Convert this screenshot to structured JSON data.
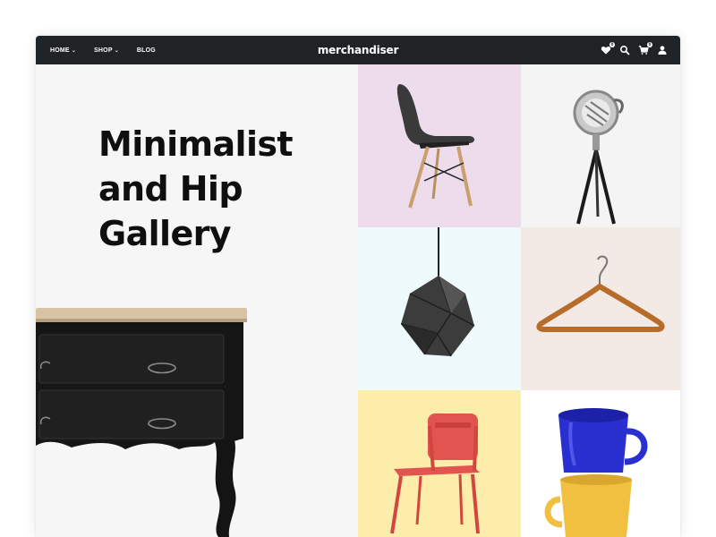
{
  "nav": {
    "items": [
      {
        "label": "HOME",
        "has_dropdown": true
      },
      {
        "label": "SHOP",
        "has_dropdown": true
      },
      {
        "label": "BLOG",
        "has_dropdown": false
      }
    ],
    "brand": "merchandiser",
    "icons": [
      "wishlist-heart-icon",
      "search-icon",
      "cart-icon",
      "account-icon"
    ],
    "wishlist_count": "0",
    "cart_count": "0"
  },
  "hero": {
    "title_lines": [
      "Minimalist",
      "and Hip",
      "Gallery"
    ]
  },
  "gallery": {
    "tiles": [
      {
        "product": "chair-black-icon",
        "bg": "#ecdcec"
      },
      {
        "product": "tripod-spotlight-icon",
        "bg": "#f4f4f4"
      },
      {
        "product": "pendant-lamp-icon",
        "bg": "#eefafb"
      },
      {
        "product": "hanger-icon",
        "bg": "#f3eae6"
      },
      {
        "product": "chair-red-icon",
        "bg": "#fcedaa"
      },
      {
        "product": "mugs-icon",
        "bg": "#ffffff"
      }
    ]
  },
  "colors": {
    "navbar": "#1f2326",
    "hero_bg": "#f6f6f6",
    "title": "#0f0f0f"
  }
}
